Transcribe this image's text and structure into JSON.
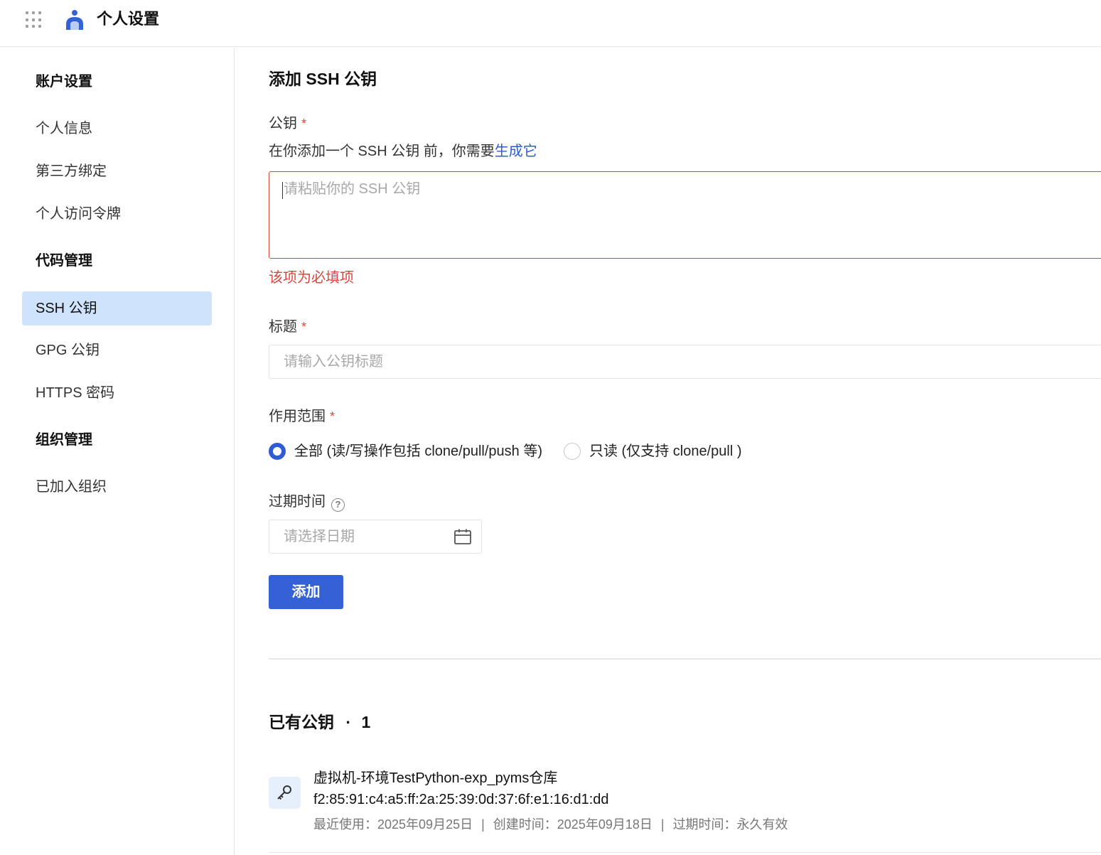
{
  "header": {
    "title": "个人设置"
  },
  "sidebar": {
    "groups": [
      {
        "label": "账户设置",
        "items": [
          "个人信息",
          "第三方绑定",
          "个人访问令牌"
        ]
      },
      {
        "label": "代码管理",
        "items": [
          "SSH 公钥",
          "GPG 公钥",
          "HTTPS 密码"
        ]
      },
      {
        "label": "组织管理",
        "items": [
          "已加入组织"
        ]
      }
    ],
    "active_item": "SSH 公钥"
  },
  "form": {
    "title": "添加 SSH 公钥",
    "pubkey_label": "公钥",
    "required_mark": "*",
    "hint_text": "在你添加一个 SSH 公钥 前，你需要",
    "hint_link": "生成它",
    "pubkey_placeholder": "请粘贴你的 SSH 公钥",
    "pubkey_error": "该项为必填项",
    "title_label": "标题",
    "title_placeholder": "请输入公钥标题",
    "scope_label": "作用范围",
    "scope_options": [
      {
        "label": "全部 (读/写操作包括 clone/pull/push 等)",
        "checked": true
      },
      {
        "label": "只读 (仅支持 clone/pull )",
        "checked": false
      }
    ],
    "expire_label": "过期时间",
    "help_glyph": "?",
    "date_placeholder": "请选择日期",
    "submit_label": "添加"
  },
  "keys": {
    "title": "已有公钥",
    "separator": "·",
    "count": "1",
    "items": [
      {
        "name": "虚拟机-环境TestPython-exp_pyms仓库",
        "fingerprint": "f2:85:91:c4:a5:ff:2a:25:39:0d:37:6f:e1:16:d1:dd",
        "last_used": "最近使用：2025年09月25日",
        "created": "创建时间：2025年09月18日",
        "expires": "过期时间：永久有效",
        "meta_sep": "|"
      }
    ]
  },
  "colors": {
    "accent": "#3461d6",
    "active_nav_bg": "#cfe4fc",
    "error": "#d9463e",
    "link": "#2f5bd3"
  },
  "icons": [
    "apps-grid-icon",
    "logo-icon",
    "help-icon",
    "calendar-icon",
    "key-icon"
  ]
}
